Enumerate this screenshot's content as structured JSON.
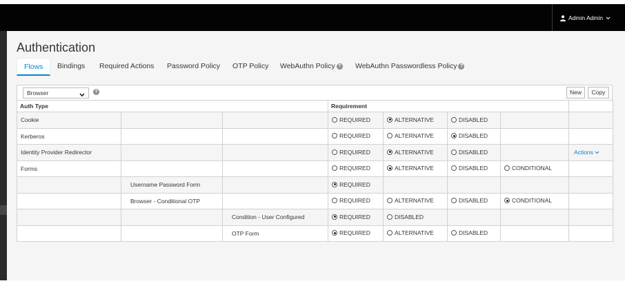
{
  "header": {
    "user_label": "Admin Admin"
  },
  "page": {
    "title": "Authentication"
  },
  "tabs": [
    {
      "label": "Flows",
      "active": true
    },
    {
      "label": "Bindings"
    },
    {
      "label": "Required Actions"
    },
    {
      "label": "Password Policy"
    },
    {
      "label": "OTP Policy"
    },
    {
      "label": "WebAuthn Policy"
    },
    {
      "label": "WebAuthn Passwordless Policy"
    }
  ],
  "toolbar": {
    "flow_select_value": "Browser",
    "new_label": "New",
    "copy_label": "Copy"
  },
  "table": {
    "headers": {
      "auth_type": "Auth Type",
      "requirement": "Requirement"
    },
    "actions_label": "Actions",
    "rows": [
      {
        "c1": "Cookie",
        "c2": "",
        "c3": "",
        "options": [
          "REQUIRED",
          "ALTERNATIVE",
          "DISABLED",
          ""
        ],
        "selected": "ALTERNATIVE",
        "actions": false
      },
      {
        "c1": "Kerberos",
        "c2": "",
        "c3": "",
        "options": [
          "REQUIRED",
          "ALTERNATIVE",
          "DISABLED",
          ""
        ],
        "selected": "DISABLED",
        "actions": false
      },
      {
        "c1": "Identity Provider Redirector",
        "c2": "",
        "c3": "",
        "options": [
          "REQUIRED",
          "ALTERNATIVE",
          "DISABLED",
          ""
        ],
        "selected": "ALTERNATIVE",
        "actions": true
      },
      {
        "c1": "Forms",
        "c2": "",
        "c3": "",
        "options": [
          "REQUIRED",
          "ALTERNATIVE",
          "DISABLED",
          "CONDITIONAL"
        ],
        "selected": "ALTERNATIVE",
        "actions": false
      },
      {
        "c1": "",
        "c2": "Username Password Form",
        "c3": "",
        "options": [
          "REQUIRED",
          "",
          "",
          ""
        ],
        "selected": "REQUIRED",
        "actions": false
      },
      {
        "c1": "",
        "c2": "Browser - Conditional OTP",
        "c3": "",
        "options": [
          "REQUIRED",
          "ALTERNATIVE",
          "DISABLED",
          "CONDITIONAL"
        ],
        "selected": "CONDITIONAL",
        "actions": false
      },
      {
        "c1": "",
        "c2": "",
        "c3": "Condition - User Configured",
        "options": [
          "REQUIRED",
          "DISABLED",
          "",
          ""
        ],
        "selected": "REQUIRED",
        "actions": false
      },
      {
        "c1": "",
        "c2": "",
        "c3": "OTP Form",
        "options": [
          "REQUIRED",
          "ALTERNATIVE",
          "DISABLED",
          ""
        ],
        "selected": "REQUIRED",
        "actions": false
      }
    ]
  }
}
